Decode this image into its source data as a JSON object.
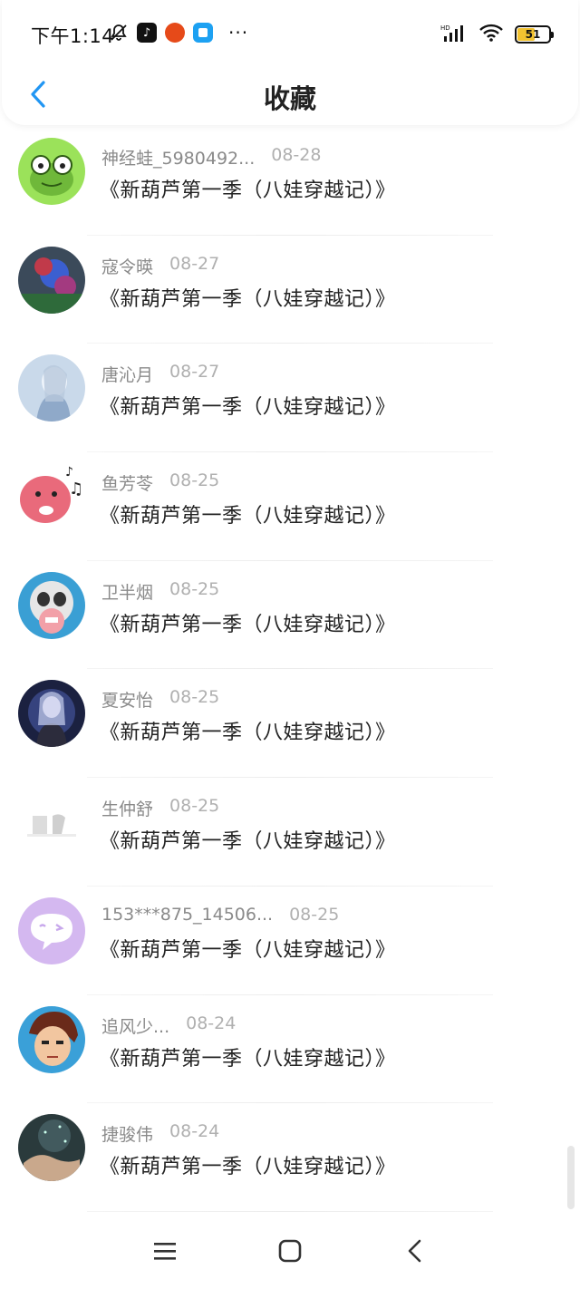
{
  "status_bar": {
    "time": "下午1:14",
    "notification_icons": [
      "bell-off-icon",
      "tiktok-icon",
      "orange-app-icon",
      "blue-app-icon"
    ],
    "more": "···",
    "battery": "51"
  },
  "nav": {
    "title": "收藏"
  },
  "items": [
    {
      "user": "神经蛙_5980492...",
      "date": "08-28",
      "title": "《新葫芦第一季（八娃穿越记）》"
    },
    {
      "user": "寇令暎",
      "date": "08-27",
      "title": "《新葫芦第一季（八娃穿越记）》"
    },
    {
      "user": "唐沁月",
      "date": "08-27",
      "title": "《新葫芦第一季（八娃穿越记）》"
    },
    {
      "user": "鱼芳苓",
      "date": "08-25",
      "title": "《新葫芦第一季（八娃穿越记）》"
    },
    {
      "user": "卫半烟",
      "date": "08-25",
      "title": "《新葫芦第一季（八娃穿越记）》"
    },
    {
      "user": "夏安怡",
      "date": "08-25",
      "title": "《新葫芦第一季（八娃穿越记）》"
    },
    {
      "user": "生仲舒",
      "date": "08-25",
      "title": "《新葫芦第一季（八娃穿越记）》"
    },
    {
      "user": "153***875_14506...",
      "date": "08-25",
      "title": "《新葫芦第一季（八娃穿越记）》"
    },
    {
      "user": "追风少...",
      "date": "08-24",
      "title": "《新葫芦第一季（八娃穿越记）》"
    },
    {
      "user": "捷骏伟",
      "date": "08-24",
      "title": "《新葫芦第一季（八娃穿越记）》"
    }
  ],
  "colors": {
    "accent": "#2196f3",
    "username": "#8a8a8a",
    "date": "#b0b0b0"
  }
}
